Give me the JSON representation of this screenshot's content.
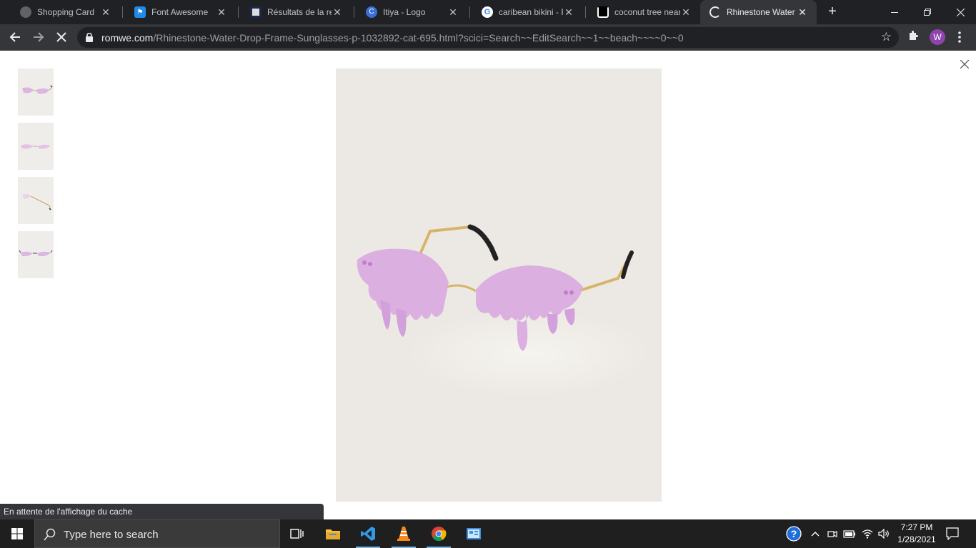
{
  "browser": {
    "tabs": [
      {
        "title": "Shopping Card",
        "favicon": "globe-icon"
      },
      {
        "title": "Font Awesome",
        "favicon": "flag-icon"
      },
      {
        "title": "Résultats de la rech",
        "favicon": "site-icon"
      },
      {
        "title": "Itiya - Logo",
        "favicon": "canva-icon"
      },
      {
        "title": "caribean bikini - Re",
        "favicon": "google-icon"
      },
      {
        "title": "coconut tree near",
        "favicon": "site-icon"
      },
      {
        "title": "Rhinestone Water",
        "favicon": "loading-icon"
      }
    ],
    "url_host": "romwe.com",
    "url_path": "/Rhinestone-Water-Drop-Frame-Sunglasses-p-1032892-cat-695.html?scici=Search~~EditSearch~~1~~beach~~~~0~~0",
    "profile_initial": "W"
  },
  "page": {
    "status_text": "En attente de l'affichage du cache",
    "thumbnails_count_label": ""
  },
  "taskbar": {
    "search_placeholder": "Type here to search",
    "time": "7:27 PM",
    "date": "1/28/2021"
  },
  "colors": {
    "lens": "#d9a9e0",
    "frame": "#d8b46a",
    "background": "#ece9e5",
    "accent": "#76b9ed"
  }
}
